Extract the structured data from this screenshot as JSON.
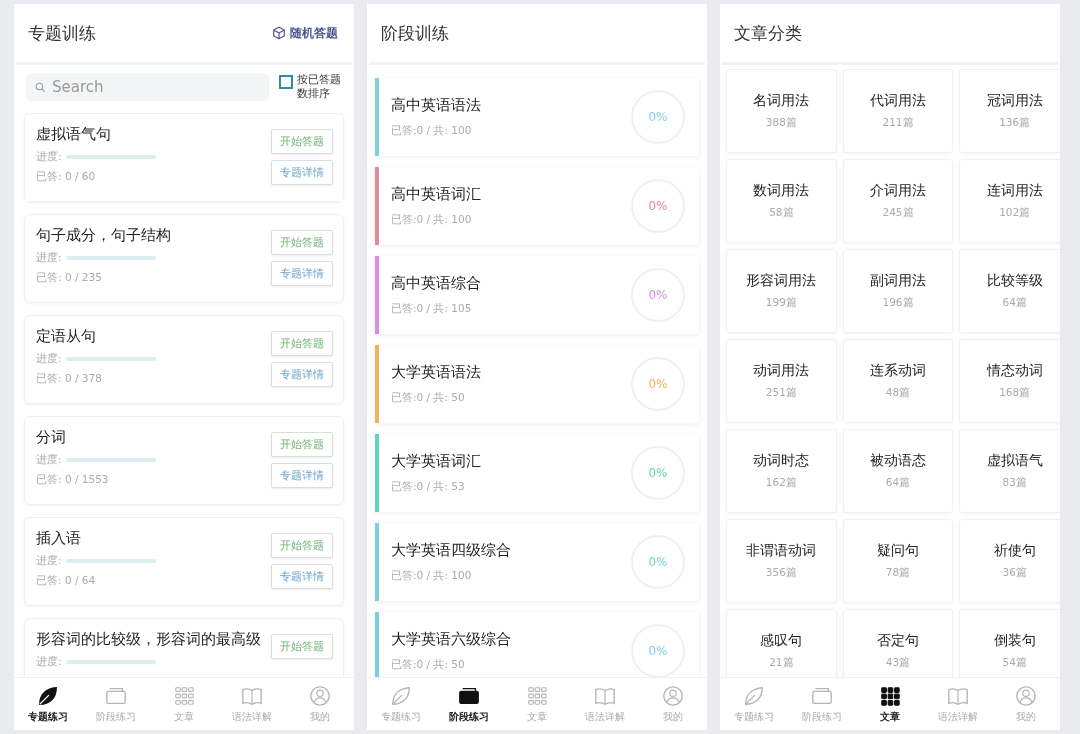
{
  "screens": [
    {
      "kind": "topics",
      "title": "专题训练",
      "random_button": "随机答题",
      "search": {
        "placeholder": "Search"
      },
      "sort_checkbox": {
        "label": "按已答题数排序",
        "checked": false
      },
      "topics": [
        {
          "title": "虚拟语气句",
          "progress_label": "进度:",
          "level": 0,
          "answered": "已答: 0 / 60",
          "start_button": "开始答题",
          "detail_button": "专题详情"
        },
        {
          "title": "句子成分，句子结构",
          "progress_label": "进度:",
          "level": 0,
          "answered": "已答: 0 / 235",
          "start_button": "开始答题",
          "detail_button": "专题详情"
        },
        {
          "title": "定语从句",
          "progress_label": "进度:",
          "level": 0,
          "answered": "已答: 0 / 378",
          "start_button": "开始答题",
          "detail_button": "专题详情"
        },
        {
          "title": "分词",
          "progress_label": "进度:",
          "level": 0,
          "answered": "已答: 0 / 1553",
          "start_button": "开始答题",
          "detail_button": "专题详情"
        },
        {
          "title": "插入语",
          "progress_label": "进度:",
          "level": 0,
          "answered": "已答: 0 / 64",
          "start_button": "开始答题",
          "detail_button": "专题详情"
        },
        {
          "title": "形容词的比较级，形容词的最高级",
          "progress_label": "进度:",
          "level": 0,
          "start_button": "开始答题"
        }
      ],
      "tabs": [
        {
          "label": "专题练习",
          "selected": true
        },
        {
          "label": "阶段练习",
          "selected": false
        },
        {
          "label": "文章",
          "selected": false
        },
        {
          "label": "语法详解",
          "selected": false
        },
        {
          "label": "我的",
          "selected": false
        }
      ]
    },
    {
      "kind": "stages",
      "title": "阶段训练",
      "stages": [
        {
          "title": "高中英语语法",
          "stats": "已答:0 / 共: 100",
          "percent": "0%",
          "color": "#7fd3d8"
        },
        {
          "title": "高中英语词汇",
          "stats": "已答:0 / 共: 100",
          "percent": "0%",
          "color": "#e48a93"
        },
        {
          "title": "高中英语综合",
          "stats": "已答:0 / 共: 105",
          "percent": "0%",
          "color": "#d98be8"
        },
        {
          "title": "大学英语语法",
          "stats": "已答:0 / 共: 50",
          "percent": "0%",
          "color": "#f0b25a"
        },
        {
          "title": "大学英语词汇",
          "stats": "已答:0 / 共: 53",
          "percent": "0%",
          "color": "#5fd6b8"
        },
        {
          "title": "大学英语四级综合",
          "stats": "已答:0 / 共: 100",
          "percent": "0%",
          "color": "#7ccfdc"
        },
        {
          "title": "大学英语六级综合",
          "stats": "已答:0 / 共: 50",
          "percent": "0%",
          "color": "#7ccfdc"
        }
      ],
      "tabs": [
        {
          "label": "专题练习",
          "selected": false
        },
        {
          "label": "阶段练习",
          "selected": true
        },
        {
          "label": "文章",
          "selected": false
        },
        {
          "label": "语法详解",
          "selected": false
        },
        {
          "label": "我的",
          "selected": false
        }
      ]
    },
    {
      "kind": "articles",
      "title": "文章分类",
      "categories": [
        {
          "name": "名词用法",
          "count": "388篇"
        },
        {
          "name": "代词用法",
          "count": "211篇"
        },
        {
          "name": "冠词用法",
          "count": "136篇"
        },
        {
          "name": "数词用法",
          "count": "58篇"
        },
        {
          "name": "介词用法",
          "count": "245篇"
        },
        {
          "name": "连词用法",
          "count": "102篇"
        },
        {
          "name": "形容词用法",
          "count": "199篇"
        },
        {
          "name": "副词用法",
          "count": "196篇"
        },
        {
          "name": "比较等级",
          "count": "64篇"
        },
        {
          "name": "动词用法",
          "count": "251篇"
        },
        {
          "name": "连系动词",
          "count": "48篇"
        },
        {
          "name": "情态动词",
          "count": "168篇"
        },
        {
          "name": "动词时态",
          "count": "162篇"
        },
        {
          "name": "被动语态",
          "count": "64篇"
        },
        {
          "name": "虚拟语气",
          "count": "83篇"
        },
        {
          "name": "非谓语动词",
          "count": "356篇"
        },
        {
          "name": "疑问句",
          "count": "78篇"
        },
        {
          "name": "祈使句",
          "count": "36篇"
        },
        {
          "name": "感叹句",
          "count": "21篇"
        },
        {
          "name": "否定句",
          "count": "43篇"
        },
        {
          "name": "倒装句",
          "count": "54篇"
        }
      ],
      "tabs": [
        {
          "label": "专题练习",
          "selected": false
        },
        {
          "label": "阶段练习",
          "selected": false
        },
        {
          "label": "文章",
          "selected": true
        },
        {
          "label": "语法详解",
          "selected": false
        },
        {
          "label": "我的",
          "selected": false
        }
      ]
    }
  ]
}
